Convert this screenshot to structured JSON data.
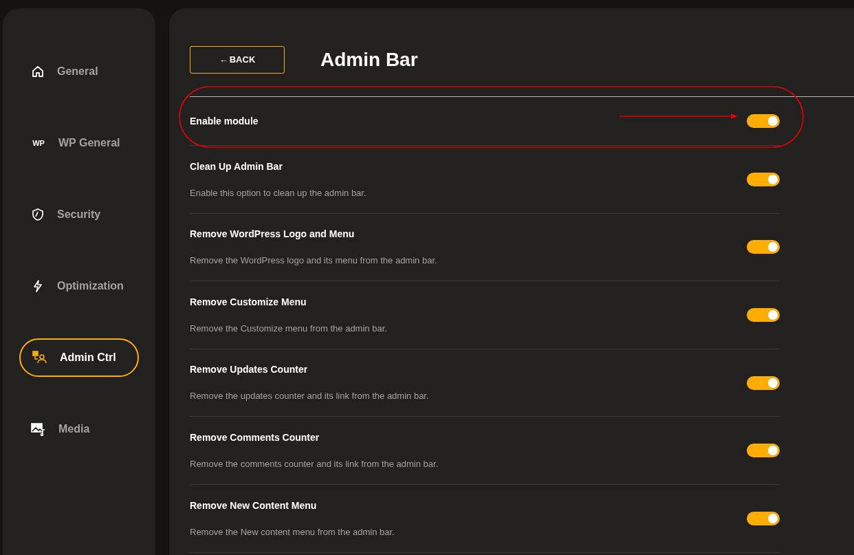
{
  "sidebar": {
    "items": [
      {
        "label": "General",
        "selected": false
      },
      {
        "label": "WP General",
        "icon_text": "WP",
        "selected": false
      },
      {
        "label": "Security",
        "selected": false
      },
      {
        "label": "Optimization",
        "selected": false
      },
      {
        "label": "Admin Ctrl",
        "selected": true
      },
      {
        "label": "Media",
        "selected": false
      }
    ]
  },
  "back_button": {
    "arrow": "←",
    "label": "BACK"
  },
  "title": "Admin Bar",
  "enable_module": {
    "label": "Enable module",
    "on": true
  },
  "options": [
    {
      "title": "Clean Up Admin Bar",
      "description": "Enable this option to clean up the admin bar.",
      "on": true
    },
    {
      "title": "Remove WordPress Logo and Menu",
      "description": "Remove the WordPress logo and its menu from the admin bar.",
      "on": true
    },
    {
      "title": "Remove Customize Menu",
      "description": "Remove the Customize menu from the admin bar.",
      "on": true
    },
    {
      "title": "Remove Updates Counter",
      "description": "Remove the updates counter and its link from the admin bar.",
      "on": true
    },
    {
      "title": "Remove Comments Counter",
      "description": "Remove the comments counter and its link from the admin bar.",
      "on": true
    },
    {
      "title": "Remove New Content Menu",
      "description": "Remove the New content menu from the admin bar.",
      "on": true
    }
  ]
}
